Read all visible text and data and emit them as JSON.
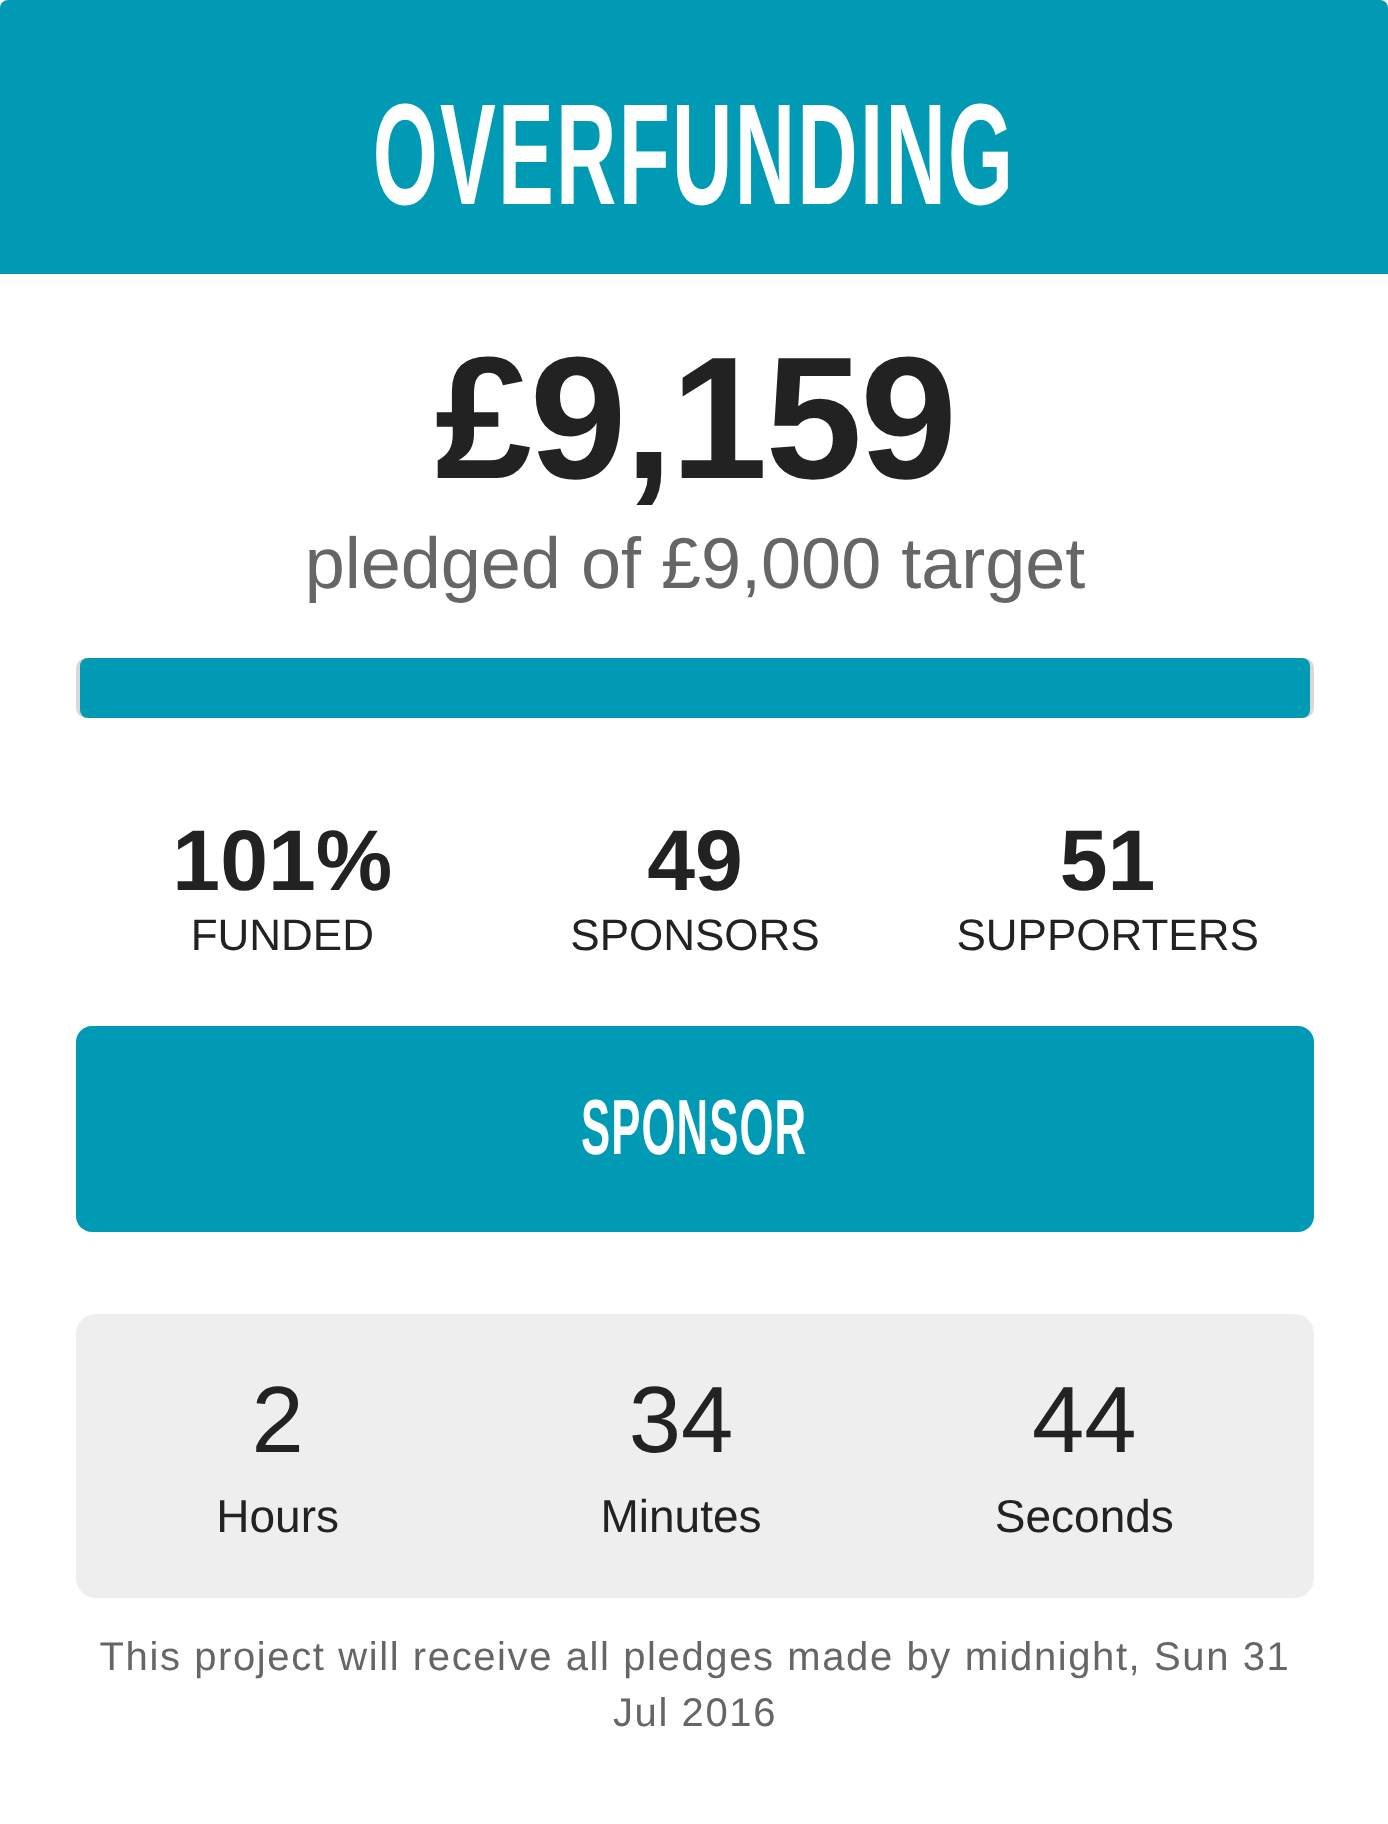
{
  "header": {
    "title": "OVERFUNDING"
  },
  "pledge": {
    "amount": "£9,159",
    "caption": "pledged of £9,000 target",
    "level": 1
  },
  "stats": [
    {
      "value": "101%",
      "label": "FUNDED"
    },
    {
      "value": "49",
      "label": "SPONSORS"
    },
    {
      "value": "51",
      "label": "SUPPORTERS"
    }
  ],
  "sponsor_button": {
    "label": "SPONSOR"
  },
  "countdown": [
    {
      "value": "2",
      "unit": "Hours"
    },
    {
      "value": "34",
      "unit": "Minutes"
    },
    {
      "value": "44",
      "unit": "Seconds"
    }
  ],
  "note": "This project will receive all pledges made by midnight, Sun 31 Jul 2016"
}
